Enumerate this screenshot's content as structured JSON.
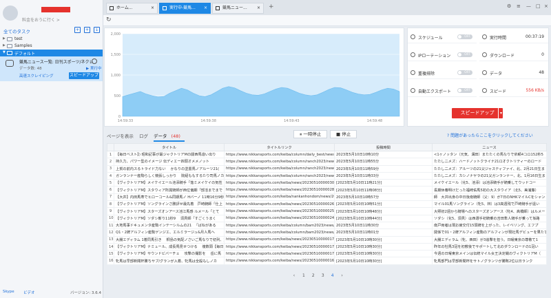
{
  "sidebar": {
    "user_name": "",
    "login_link": "料金をおうに行く >",
    "task_header": "全てのタスク",
    "tree": [
      {
        "label": "test",
        "expanded": false
      },
      {
        "label": "Samples",
        "expanded": false
      },
      {
        "label": "デフォルト",
        "expanded": true,
        "selected": true
      }
    ],
    "task": {
      "name": "競馬ニュース一覧: 日刊スポーツ/ネクレイ...",
      "count": "データ数: 48",
      "state": "▶ 実行中",
      "speed_mode": "高速スクレイピング",
      "speed_button": "スピードアップ"
    },
    "footer": {
      "skype": "Skype",
      "mail": "ビデオ",
      "version": "バージョン: 3.6.4"
    }
  },
  "tabs": [
    {
      "label": "ホーム...",
      "active": false
    },
    {
      "label": "実行中-競馬...",
      "active": true
    },
    {
      "label": "競馬ニュー...",
      "active": false
    }
  ],
  "chart_data": {
    "type": "area",
    "y_ticks": [
      "2,000",
      "1,500",
      "1,000",
      "500",
      "0"
    ],
    "x_ticks": [
      "14:59:33",
      "14:59:38",
      "14:59:43",
      "14:59:48"
    ],
    "ylim": [
      0,
      2000
    ],
    "values": [
      480,
      520,
      560,
      600,
      540,
      500,
      470,
      480,
      560,
      620,
      680,
      640,
      560,
      500,
      480,
      520,
      600,
      680,
      720,
      690,
      620,
      560,
      520,
      510,
      540,
      600,
      660,
      700,
      680,
      620,
      560,
      520,
      500,
      520,
      580,
      650,
      700,
      690,
      640,
      580,
      540,
      520,
      530,
      580,
      640,
      680,
      660,
      600
    ],
    "color": "#8ecdf5"
  },
  "stats": {
    "schedule": {
      "label": "スケジュール",
      "toggle": "OFF"
    },
    "run_time": {
      "label": "実行時間",
      "value": "00:37:19"
    },
    "ip_rotation": {
      "label": "IPローテーション",
      "toggle": "OFF"
    },
    "download": {
      "label": "ダウンロード",
      "value": "0"
    },
    "dedupe": {
      "label": "重複排除",
      "toggle": "OFF"
    },
    "data": {
      "label": "データ",
      "value": "48"
    },
    "auto_export": {
      "label": "自動エクスポート",
      "toggle": "OFF"
    },
    "speed": {
      "label": "スピード",
      "value": "556 KB/s"
    },
    "speedup_button": "スピードアップ"
  },
  "data_section": {
    "view_tabs": {
      "page": "ページを表示",
      "log": "ログ",
      "data": "データ",
      "data_count": "(48)"
    },
    "pause_button": "一時停止",
    "stop_button": "停止",
    "help_link": "問題があったらここをクリックしてください",
    "columns": [
      "",
      "タイトル",
      "タイトルリンク",
      "投稿時間",
      "ニュース"
    ],
    "rows": [
      [
        "1",
        "【毎日ベスト】) 昭和記事が最ジャクトリアMの闘西馬造い出り",
        "https://www.nikkansports.com/keiba/column/daily_best/news/202",
        "2023年5月10日10時10分",
        "<1ヶノッタン（元気、溝田）またたくの馬なりで依頼4コロ152秒5"
      ],
      [
        "2",
        "持久力、パワー型のイメージ 伝ディエー四頭オメメノット",
        "https://www.nikkansports.com/keiba/column/ranch2023/news/202",
        "2023年5月10日11時55分",
        "たたし二メズ：ハードノットクライナ21ロオクトリティーのロード"
      ],
      [
        "3",
        "上賀の前内スるトライド力ない 　かなりの塗置馬ノアルーツ21(",
        "https://www.nikkansports.com/keiba/column/ranch2023/news/202",
        "2023年5月10日11時59分",
        "たたし二メズ：アルーツの21父ジャスティファイ、北、2月21日生ま"
      ],
      [
        "4",
        "ガンランナー産駒らしく競張しっかり 　院紹ももするたり司馬ノカン",
        "https://www.nikkansports.com/keiba/column/ranch2023/news/202",
        "2023年5月10日11時33分",
        "たたし二メズ：カシノナヤラの21父ガンランナー、北、1月16日生ま"
      ],
      [
        "5",
        "【ヴィクトリアM】メイケイエール池添騎手「落ミメイケイの気性",
        "https://www.nikkansports.com/keiba/news/202305100000303.html",
        "[2023年5月10日11時21分]",
        "メイケイエール（化5、池添）は池添騎手が騎乗してウッドコー"
      ],
      [
        "6",
        "【ヴィクトリアM】スタウィア所属騎師が西位偏期「部活までまで",
        "https://www.nikkansports.com/keiba/news/202305100000289.html",
        "[2023年5月10日11時08分]",
        "長期休養明けだった福崎佑馬5初の大スタウイア（北5、美浦藤）"
      ],
      [
        "7",
        "【大井】内田馬寿でヒローコール&同期馬ノ Hバーノ 11時16分9秒",
        "https://www.nikkansports.com/keiba/nankanhondom/news/20230",
        "2023年5月10日10時57分",
        "師　大井出身の中日後南騎師（父：9）が7日のNHKマイルCをシャン"
      ],
      [
        "8",
        "【ヴィクトリアM】ソングラインさ勝評せ最先着　戸崎騎師「仕上",
        "https://www.nikkansports.com/keiba/news/202305100000261.html",
        "[2023年5月10日10時51分]",
        "マイル01馬ソングライン（牝5、林）は3高週残で戸崎騎手が遠い"
      ],
      [
        "9",
        "【ヴィクトリアM】スターズオンアース池江馬感 ルメール「とて",
        "https://www.nikkansports.com/keiba/news/202305100000250.html",
        "[2023年5月10日10時48分]",
        "大照初2週から騎場へのスターズオンアース（牝4、高橋師）はルメー"
      ],
      [
        "10",
        "【ヴィクトリアM】ソダシ斬り11秒9 　須貝師「すごくうまく",
        "https://www.nikkansports.com/keiba/news/202305100000242.html",
        "[2023年5月10日10時44分]",
        "ソダシ（化5、須貝）は西選手初騎乗の吉田隼人騎手が乗って坂路"
      ],
      [
        "11",
        "大地馬事ドキュメンタ産駒インテーシルムの21 　「ばねがある",
        "https://www.nikkansports.com/keiba/column/bam2023/news/2023",
        "2023年5月10日11時30分",
        "南戸両者は現お疲交付15頭牌を上がった、レイベリング、エフプ"
      ],
      [
        "12",
        "Q1・2牌アルフィン産駒ゲンジエ、エルミラージュ&月人馬へ",
        "https://www.nikkansports.com/keiba/column/bam2023/news/2023",
        "2023年5月10日11時01分",
        "関係で01・2牌アルフィン産駒のアルフィンが現社馬デビューを果たす。最"
      ],
      [
        "13",
        "大腸エディラム 1着同馬引き 　桐島の気配ノさいご馬なりで初列、東",
        "https://www.nikkansports.com/keiba/news/202305100000173.html",
        "[2023年5月10日10時30分]",
        "大腸エディラム（牝、西田）が3追撃を担う。日曜東京の尊敬て1"
      ],
      [
        "14",
        "【ヴィクトリアM】ナミュール、成長馬見せつける 　複数頭【毎日ベ",
        "https://www.nikkansports.com/keiba/news/202305100000172.html",
        "[2023年5月10日10時30分]",
        "昨年の牡馬3冠を初敷後でサポートして北のダウンロードの1冠い"
      ],
      [
        "15",
        "【ヴィクトリアM】サウンドビバーチェ 　攻撃の撮影を 　岳に馬",
        "https://www.nikkansports.com/keiba/news/202305100000171.html",
        "[2023年5月10日10時30分]",
        "今週の日曜東京メインは伝統マイル女王決定戦のヴィクトリアM（"
      ],
      [
        "16",
        "牝馬は早部新聞杯勝ちサブ/グランが入着、牝馬は全般もしノカ",
        "https://www.nikkansports.com/keiba/news/202305100000169.html",
        "[2023年5月10日10時30分]",
        "牝馬部門は早部新聞杯をサトノグランツが勝敗2位以日ランク"
      ]
    ],
    "pager": {
      "prev": "‹",
      "pages": [
        "1",
        "2",
        "3",
        "4"
      ],
      "current": "4",
      "next": "›"
    }
  }
}
